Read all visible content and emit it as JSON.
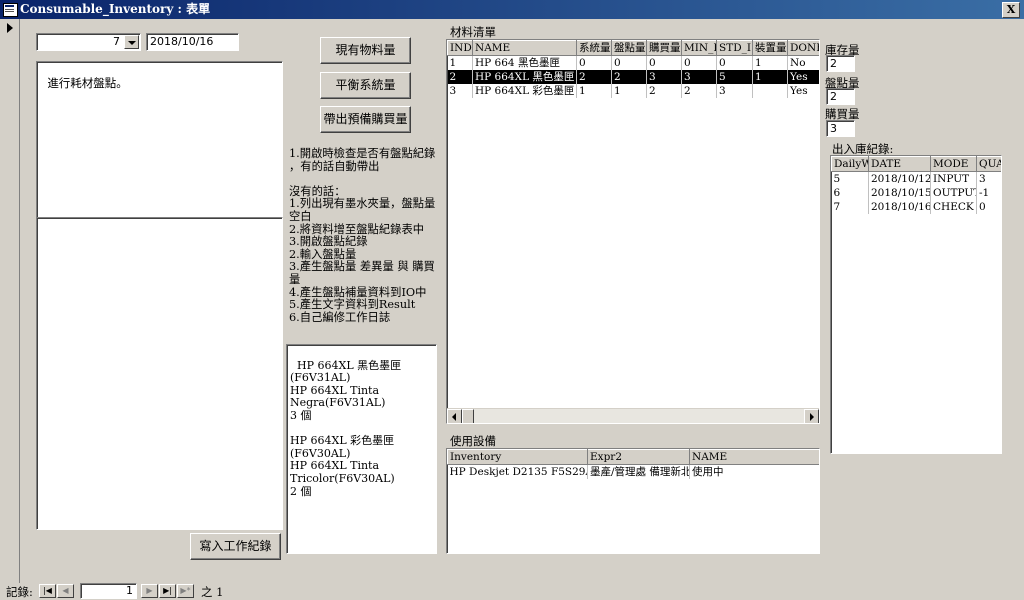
{
  "window": {
    "title": "Consumable_Inventory : 表單",
    "close_glyph": "X"
  },
  "top": {
    "combo_value": "7",
    "date_value": "2018/10/16"
  },
  "memo1": "進行耗材盤點。",
  "memo2": "",
  "buttons": {
    "current_stock": "現有物料量",
    "balance_system": "平衡系統量",
    "bring_purchase": "帶出預備購買量",
    "write_log": "寫入工作紀錄"
  },
  "notes": "1.開啟時檢查是否有盤點紀錄\n，有的話自動帶出\n\n沒有的話：\n1.列出現有墨水夾量，盤點量\n空白\n2.將資料增至盤點紀錄表中\n3.開啟盤點紀錄\n2.輸入盤點量\n3.產生盤點量 差異量 與 購買\n量\n4.產生盤點補量資料到IO中\n5.產生文字資料到Result\n6.自己編修工作日誌",
  "result_text": "HP 664XL 黑色墨匣\n(F6V31AL)\nHP 664XL Tinta\nNegra(F6V31AL)\n3 個\n\nHP 664XL 彩色墨匣\n(F6V30AL)\nHP 664XL Tinta\nTricolor(F6V30AL)\n2 個",
  "materials": {
    "label": "材料清單",
    "headers": [
      "INDI",
      "NAME",
      "系統量",
      "盤點量",
      "購買量",
      "MIN_I",
      "STD_I",
      "裝置量",
      "DONE"
    ],
    "rows": [
      [
        "1",
        "HP 664 黑色墨匣",
        "0",
        "0",
        "0",
        "0",
        "0",
        "1",
        "No"
      ],
      [
        "2",
        "HP 664XL 黑色墨匣",
        "2",
        "2",
        "3",
        "3",
        "5",
        "1",
        "Yes"
      ],
      [
        "3",
        "HP 664XL 彩色墨匣",
        "1",
        "1",
        "2",
        "2",
        "3",
        "",
        "Yes"
      ]
    ],
    "selected_row": 1
  },
  "side_fields": {
    "stock_label": "庫存量",
    "stock_value": "2",
    "count_label": "盤點量",
    "count_value": "2",
    "purchase_label": "購買量",
    "purchase_value": "3"
  },
  "io": {
    "label": "出入庫紀錄:",
    "headers": [
      "DailyW",
      "DATE",
      "MODE",
      "QUA"
    ],
    "rows": [
      [
        "5",
        "2018/10/12",
        "INPUT",
        "3"
      ],
      [
        "6",
        "2018/10/15",
        "OUTPUT",
        "-1"
      ],
      [
        "7",
        "2018/10/16",
        "CHECK",
        "0"
      ]
    ]
  },
  "devices": {
    "label": "使用設備",
    "headers": [
      "Inventory",
      "Expr2",
      "NAME"
    ],
    "rows": [
      [
        "HP Deskjet D2135 F5S29A",
        "墨產/管理處 備理新北",
        "使用中"
      ]
    ]
  },
  "record_nav": {
    "label": "記錄:",
    "current": "1",
    "of_label": "之 1"
  }
}
